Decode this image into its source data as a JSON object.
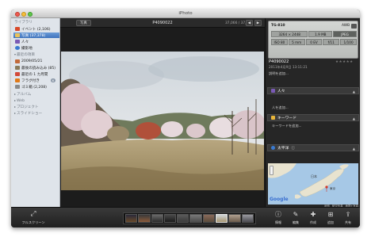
{
  "window": {
    "title": "iPhoto"
  },
  "sidebar": {
    "library_header": "ライブラリ",
    "library_items": [
      {
        "label": "イベント (2,106)",
        "icon": "events-icon",
        "color": "#d94a2a"
      },
      {
        "label": "写真 (37,378)",
        "icon": "photos-icon",
        "color": "#e8c15a",
        "selected": true
      },
      {
        "label": "人々",
        "icon": "faces-icon",
        "color": "#7a5ab5"
      },
      {
        "label": "撮影地",
        "icon": "places-icon",
        "color": "#3a7ad0"
      }
    ],
    "recent_header": "最近の項目",
    "recent_items": [
      {
        "label": "2009/05/21",
        "icon": "event-icon",
        "color": "#c26a3a"
      },
      {
        "label": "最後の読み込み (85)",
        "icon": "last-import-icon",
        "color": "#8a7a5a"
      },
      {
        "label": "最近の 1 カ月間",
        "icon": "calendar-icon",
        "color": "#d24a3a"
      },
      {
        "label": "フラグ付き",
        "icon": "flag-icon",
        "color": "#e07a1a",
        "badge": "6"
      },
      {
        "label": "ゴミ箱 (2,208)",
        "icon": "trash-icon",
        "color": "#8a8a8a"
      }
    ],
    "groups": [
      "アルバム",
      "Web",
      "プロジェクト",
      "スライドショー"
    ]
  },
  "photo_toolbar": {
    "photo_button": "写真",
    "title": "P4090022",
    "count": "37,066 / 37,378",
    "prev": "◀",
    "next": "▶"
  },
  "info": {
    "camera": "TG-810",
    "awb": "AWB",
    "resolution": "3264 × 2448",
    "filesize": "1.9 MB",
    "format": "JPEG",
    "exif": [
      "ISO 80",
      "5 mm",
      "0 EV",
      "f/11",
      "1/100"
    ],
    "photo_title": "P4090022",
    "date": "2011年4月9日 13:11:21",
    "description_placeholder": "説明を追加...",
    "faces_header": "人々",
    "faces_placeholder": "人を追加...",
    "keywords_header": "キーワード",
    "keywords_placeholder": "キーワードを追加...",
    "places_header": "太平洋",
    "map_labels": [
      "日本",
      "東京"
    ],
    "map_logo": "Google",
    "map_tabs": [
      "地形",
      "航空写真",
      "地図+写真"
    ]
  },
  "bottom_toolbar": {
    "fullscreen": "フルスクリーン",
    "buttons": [
      {
        "label": "情報",
        "icon": "info-icon",
        "glyph": "ⓘ"
      },
      {
        "label": "編集",
        "icon": "edit-icon",
        "glyph": "✎"
      },
      {
        "label": "作成",
        "icon": "create-icon",
        "glyph": "✚"
      },
      {
        "label": "追加",
        "icon": "add-icon",
        "glyph": "⊞"
      },
      {
        "label": "共有",
        "icon": "share-icon",
        "glyph": "⇪"
      }
    ]
  }
}
